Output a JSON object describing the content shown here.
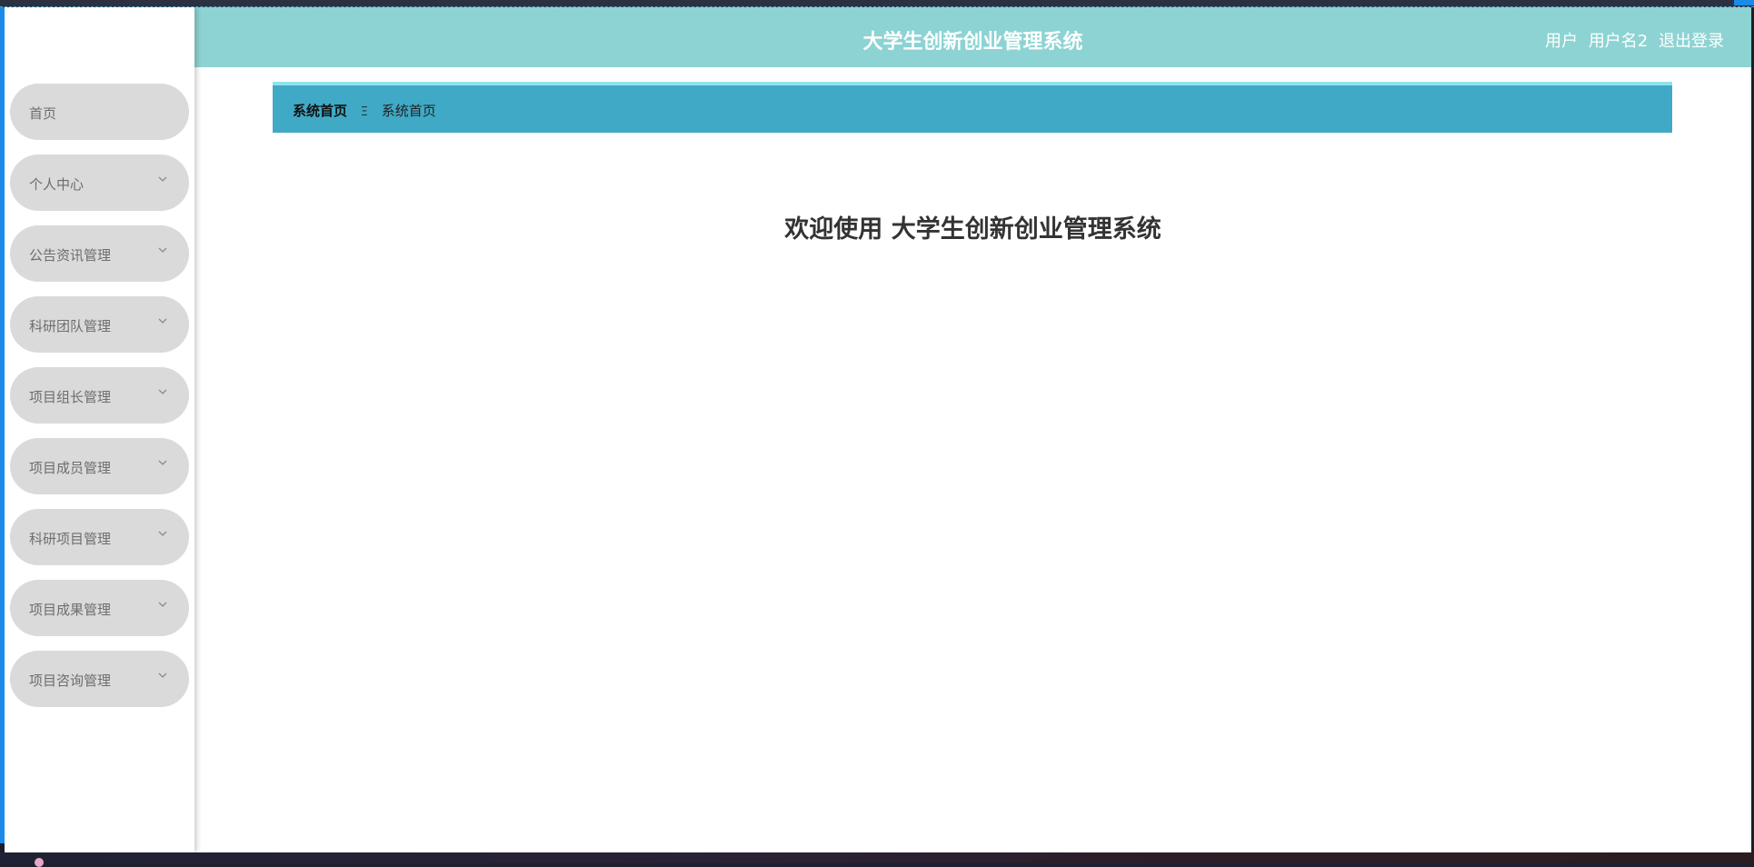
{
  "app": {
    "title": "大学生创新创业管理系统"
  },
  "header": {
    "role_label": "用户",
    "username": "用户名2",
    "logout_label": "退出登录"
  },
  "sidebar": {
    "items": [
      {
        "label": "首页",
        "has_children": false
      },
      {
        "label": "个人中心",
        "has_children": true
      },
      {
        "label": "公告资讯管理",
        "has_children": true
      },
      {
        "label": "科研团队管理",
        "has_children": true
      },
      {
        "label": "项目组长管理",
        "has_children": true
      },
      {
        "label": "项目成员管理",
        "has_children": true
      },
      {
        "label": "科研项目管理",
        "has_children": true
      },
      {
        "label": "项目成果管理",
        "has_children": true
      },
      {
        "label": "项目咨询管理",
        "has_children": true
      }
    ]
  },
  "breadcrumb": {
    "root": "系统首页",
    "separator": "Ξ",
    "current": "系统首页"
  },
  "main": {
    "welcome": "欢迎使用 大学生创新创业管理系统"
  },
  "colors": {
    "header_bg": "#8dd3d3",
    "breadcrumb_bg": "#40a9c6",
    "menu_item_bg": "#dadada",
    "accent_blue": "#1a8be8"
  },
  "icons": {
    "menu_expand": "chevron-down-icon",
    "breadcrumb_separator": "menu-lines-icon"
  }
}
